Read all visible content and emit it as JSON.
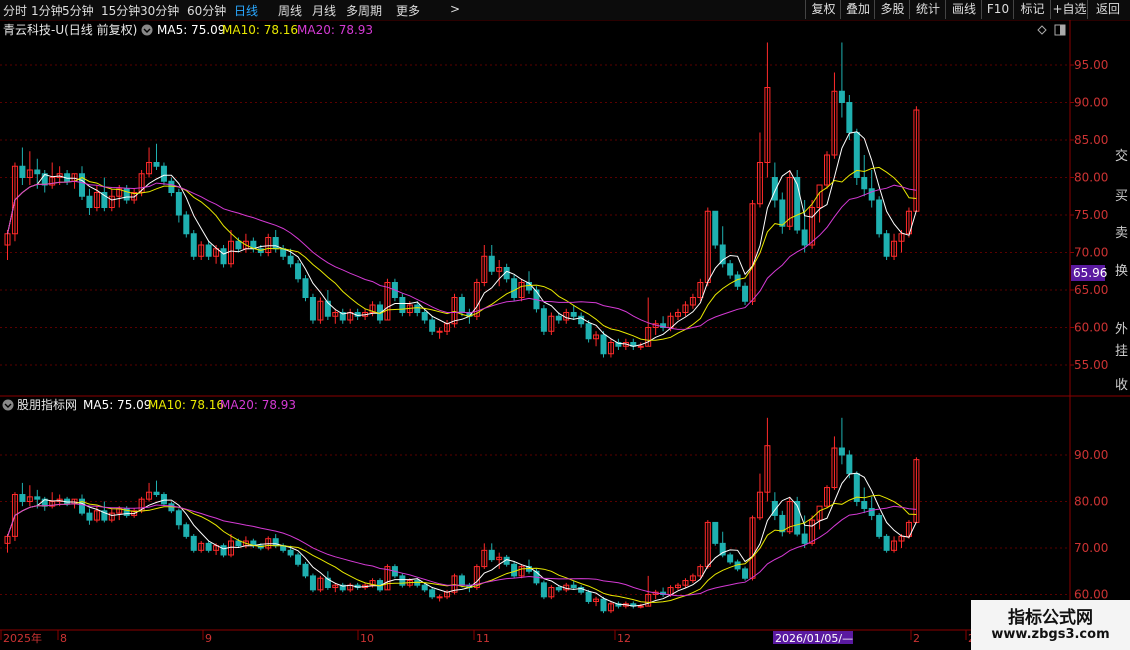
{
  "toolbar": {
    "periods": [
      "分时",
      "1分钟",
      "5分钟",
      "15分钟",
      "30分钟",
      "60分钟",
      "日线",
      "周线",
      "月线",
      "多周期",
      "更多"
    ],
    "active_period": "日线",
    "more_icon": "chevron-right-icon",
    "right_buttons": [
      "复权",
      "叠加",
      "多股",
      "统计",
      "画线",
      "F10",
      "标记",
      "+自选",
      "返回"
    ]
  },
  "main_panel": {
    "title": "青云科技-U(日线 前复权)",
    "indicator_icon": "chevron-down-circle-icon",
    "ma5_label": "MA5: 75.09",
    "ma10_label": "MA10: 78.16",
    "ma20_label": "MA20: 78.93",
    "price_tag": "65.96",
    "y_ticks": [
      "95.00",
      "90.00",
      "85.00",
      "80.00",
      "75.00",
      "70.00",
      "65.00",
      "60.00",
      "55.00"
    ]
  },
  "sub_panel": {
    "title": "股朋指标网",
    "ma5_label": "MA5: 75.09",
    "ma10_label": "MA10: 78.16",
    "ma20_label": "MA20: 78.93",
    "y_ticks": [
      "90.00",
      "80.00",
      "70.00",
      "60.00"
    ]
  },
  "x_axis": {
    "labels": [
      "2025年",
      "8",
      "9",
      "10",
      "11",
      "12",
      "2",
      "2"
    ],
    "cursor_date": "2026/01/05/—"
  },
  "right_strip_chars": [
    "交",
    "买",
    "卖",
    "换",
    "外",
    "挂",
    "收"
  ],
  "watermark": {
    "line1": "指标公式网",
    "line2": "www.zbgs3.com"
  },
  "colors": {
    "up": "#ff2a2a",
    "down": "#1fb0b0",
    "ma5": "#ffffff",
    "ma10": "#e8e800",
    "ma20": "#d43ad4",
    "grid": "#5a0000",
    "active_tab": "#2aa8ff",
    "price_tag_bg": "#5a1aa0"
  },
  "chart_data": {
    "type": "candlestick",
    "ylim": [
      52,
      99
    ],
    "candles": [
      [
        71.0,
        73.0,
        69.0,
        72.5
      ],
      [
        72.5,
        82.0,
        71.5,
        81.5
      ],
      [
        81.5,
        84.0,
        79.0,
        80.0
      ],
      [
        80.0,
        83.5,
        79.0,
        81.0
      ],
      [
        81.0,
        82.5,
        78.5,
        80.5
      ],
      [
        80.5,
        81.0,
        78.0,
        79.0
      ],
      [
        79.0,
        82.0,
        78.5,
        80.0
      ],
      [
        80.0,
        81.5,
        79.0,
        80.5
      ],
      [
        80.5,
        81.0,
        79.0,
        79.5
      ],
      [
        79.5,
        80.5,
        78.5,
        80.5
      ],
      [
        80.5,
        81.5,
        77.0,
        77.5
      ],
      [
        77.5,
        78.5,
        75.0,
        76.0
      ],
      [
        76.0,
        79.0,
        75.5,
        78.0
      ],
      [
        78.0,
        80.0,
        75.5,
        76.0
      ],
      [
        76.0,
        78.5,
        75.5,
        77.5
      ],
      [
        77.5,
        79.0,
        76.0,
        78.5
      ],
      [
        78.5,
        79.0,
        76.5,
        77.0
      ],
      [
        77.0,
        78.5,
        76.5,
        78.0
      ],
      [
        78.0,
        81.0,
        77.5,
        80.5
      ],
      [
        80.5,
        84.0,
        80.0,
        82.0
      ],
      [
        82.0,
        84.5,
        81.0,
        81.5
      ],
      [
        81.5,
        82.0,
        79.0,
        79.5
      ],
      [
        79.5,
        80.0,
        77.5,
        78.0
      ],
      [
        78.0,
        78.5,
        74.0,
        75.0
      ],
      [
        75.0,
        75.5,
        72.0,
        72.5
      ],
      [
        72.5,
        73.0,
        69.0,
        69.5
      ],
      [
        69.5,
        71.5,
        69.0,
        71.0
      ],
      [
        71.0,
        71.5,
        69.0,
        69.5
      ],
      [
        69.5,
        71.0,
        68.5,
        70.5
      ],
      [
        70.5,
        71.0,
        68.0,
        68.5
      ],
      [
        68.5,
        73.0,
        68.0,
        71.5
      ],
      [
        71.5,
        72.0,
        70.0,
        70.5
      ],
      [
        70.5,
        72.5,
        70.0,
        71.5
      ],
      [
        71.5,
        72.0,
        70.0,
        70.5
      ],
      [
        70.5,
        71.0,
        69.5,
        70.0
      ],
      [
        70.0,
        72.5,
        69.5,
        72.0
      ],
      [
        72.0,
        73.0,
        70.0,
        70.5
      ],
      [
        70.5,
        71.0,
        69.0,
        69.5
      ],
      [
        69.5,
        70.5,
        68.0,
        68.5
      ],
      [
        68.5,
        69.0,
        66.0,
        66.5
      ],
      [
        66.5,
        67.0,
        63.5,
        64.0
      ],
      [
        64.0,
        64.5,
        60.5,
        61.0
      ],
      [
        61.0,
        64.0,
        60.5,
        63.5
      ],
      [
        63.5,
        65.0,
        61.0,
        61.5
      ],
      [
        61.5,
        62.5,
        60.5,
        62.0
      ],
      [
        62.0,
        62.5,
        60.5,
        61.0
      ],
      [
        61.0,
        62.5,
        60.5,
        62.0
      ],
      [
        62.0,
        62.5,
        61.0,
        61.5
      ],
      [
        61.5,
        62.5,
        61.0,
        62.0
      ],
      [
        62.0,
        63.5,
        61.5,
        63.0
      ],
      [
        63.0,
        63.5,
        60.5,
        61.0
      ],
      [
        61.0,
        66.5,
        61.0,
        66.0
      ],
      [
        66.0,
        66.5,
        63.5,
        64.0
      ],
      [
        64.0,
        64.5,
        61.5,
        62.0
      ],
      [
        62.0,
        63.5,
        61.5,
        63.0
      ],
      [
        63.0,
        63.5,
        61.5,
        62.0
      ],
      [
        62.0,
        62.5,
        60.5,
        61.0
      ],
      [
        61.0,
        61.5,
        59.0,
        59.5
      ],
      [
        59.5,
        60.0,
        58.5,
        59.5
      ],
      [
        59.5,
        61.0,
        59.0,
        60.5
      ],
      [
        60.5,
        64.5,
        60.0,
        64.0
      ],
      [
        64.0,
        64.5,
        61.5,
        62.0
      ],
      [
        62.0,
        62.5,
        60.5,
        61.5
      ],
      [
        61.5,
        66.5,
        61.0,
        66.0
      ],
      [
        66.0,
        71.0,
        65.5,
        69.5
      ],
      [
        69.5,
        71.0,
        67.0,
        67.5
      ],
      [
        67.5,
        69.0,
        65.5,
        68.0
      ],
      [
        68.0,
        68.5,
        66.0,
        66.5
      ],
      [
        66.5,
        67.0,
        63.5,
        64.0
      ],
      [
        64.0,
        66.5,
        63.5,
        66.0
      ],
      [
        66.0,
        67.5,
        64.5,
        65.0
      ],
      [
        65.0,
        65.5,
        62.0,
        62.5
      ],
      [
        62.5,
        63.0,
        59.0,
        59.5
      ],
      [
        59.5,
        62.0,
        59.0,
        61.5
      ],
      [
        61.5,
        62.0,
        60.5,
        61.0
      ],
      [
        61.0,
        62.5,
        60.5,
        62.0
      ],
      [
        62.0,
        63.0,
        61.0,
        61.5
      ],
      [
        61.5,
        62.0,
        60.0,
        60.5
      ],
      [
        60.5,
        61.0,
        58.0,
        58.5
      ],
      [
        58.5,
        59.5,
        57.5,
        59.0
      ],
      [
        59.0,
        59.5,
        56.0,
        56.5
      ],
      [
        56.5,
        58.5,
        56.0,
        58.0
      ],
      [
        58.0,
        58.5,
        57.0,
        57.5
      ],
      [
        57.5,
        58.5,
        57.0,
        58.0
      ],
      [
        58.0,
        58.5,
        57.0,
        57.5
      ],
      [
        57.5,
        58.0,
        57.0,
        57.5
      ],
      [
        57.5,
        64.0,
        57.5,
        60.0
      ],
      [
        60.0,
        61.0,
        59.0,
        60.5
      ],
      [
        60.5,
        61.5,
        59.5,
        60.0
      ],
      [
        60.0,
        62.0,
        59.5,
        61.5
      ],
      [
        61.5,
        62.5,
        61.0,
        62.0
      ],
      [
        62.0,
        63.5,
        61.5,
        63.0
      ],
      [
        63.0,
        64.5,
        62.5,
        64.0
      ],
      [
        64.0,
        66.5,
        63.5,
        66.0
      ],
      [
        66.0,
        76.0,
        65.5,
        75.5
      ],
      [
        75.5,
        75.5,
        70.5,
        71.0
      ],
      [
        71.0,
        73.5,
        68.0,
        68.5
      ],
      [
        68.5,
        69.0,
        66.5,
        67.0
      ],
      [
        67.0,
        67.5,
        65.0,
        65.5
      ],
      [
        65.5,
        66.0,
        63.0,
        63.5
      ],
      [
        63.5,
        77.0,
        63.0,
        76.5
      ],
      [
        76.5,
        86.0,
        76.0,
        82.0
      ],
      [
        82.0,
        98.0,
        80.0,
        92.0
      ],
      [
        80.0,
        82.0,
        76.0,
        77.0
      ],
      [
        77.0,
        78.0,
        72.5,
        73.5
      ],
      [
        73.5,
        81.0,
        73.0,
        80.0
      ],
      [
        80.0,
        81.0,
        72.5,
        73.0
      ],
      [
        73.0,
        77.0,
        70.0,
        71.0
      ],
      [
        71.0,
        77.0,
        70.5,
        76.0
      ],
      [
        76.0,
        78.0,
        74.0,
        79.0
      ],
      [
        79.0,
        83.5,
        78.5,
        83.0
      ],
      [
        83.0,
        94.0,
        82.5,
        91.5
      ],
      [
        91.5,
        98.0,
        88.0,
        90.0
      ],
      [
        90.0,
        91.0,
        85.0,
        86.0
      ],
      [
        86.0,
        86.5,
        79.0,
        80.0
      ],
      [
        80.0,
        83.0,
        77.5,
        78.5
      ],
      [
        78.5,
        81.0,
        76.0,
        77.0
      ],
      [
        77.0,
        77.5,
        72.0,
        72.5
      ],
      [
        72.5,
        73.0,
        69.0,
        69.5
      ],
      [
        69.5,
        72.5,
        69.0,
        71.5
      ],
      [
        71.5,
        73.0,
        70.0,
        72.5
      ],
      [
        72.5,
        76.0,
        72.0,
        75.5
      ],
      [
        75.5,
        89.5,
        75.5,
        89.0
      ]
    ],
    "ma_series": [
      "MA5",
      "MA10",
      "MA20"
    ],
    "series_values": {
      "MA5_end": 75.09,
      "MA10_end": 78.16,
      "MA20_end": 78.93
    },
    "grid": true
  }
}
